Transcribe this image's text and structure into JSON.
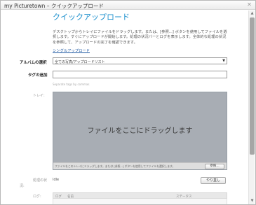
{
  "window": {
    "title": "my Picturetown – クイックアップロード",
    "close_icon": "✕"
  },
  "header": {
    "heading": "クイックアップロード",
    "description": "デスクトップからトレイにファイルをドラッグします。または、[参照...] ボタンを使用してファイルを選択します。すぐにアップロードが開始します。処理の状況バーとログを表示します。全体的な処理の状況を参照して、アップロードの完了を確認できます。",
    "single_upload_link": "シングルアップロード"
  },
  "form": {
    "album_label": "アルバムの選択",
    "album_value": "全ての写真/アップロードリスト",
    "tags_label": "タグの追加",
    "tags_value": "",
    "tags_hint": "Separate tags by commas"
  },
  "tray": {
    "label": "トレイ:",
    "drop_text": "ファイルをここにドラッグします",
    "footer_note": "ファイルをこのトレイにドラッグします。または [参照...] ボタンを使用してファイルを選択します。",
    "browse_button": "参照..."
  },
  "status": {
    "label": "処理の状",
    "label_suffix": "況:",
    "value": "Idle",
    "retry_button": "やり直し"
  },
  "log": {
    "label": "ログ:",
    "columns": [
      "ログ",
      "名前",
      "ステータス"
    ]
  }
}
